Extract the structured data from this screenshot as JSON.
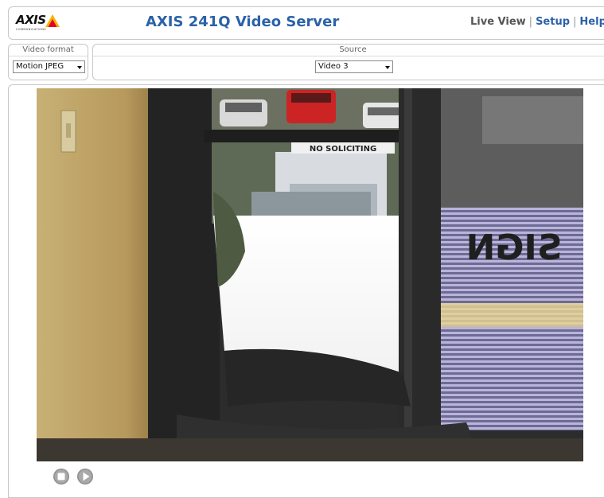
{
  "brand": {
    "logo_text": "AXIS",
    "logo_subtext": "COMMUNICATIONS",
    "logo_colors": [
      "#f6b400",
      "#e3002b"
    ]
  },
  "header": {
    "title": "AXIS 241Q Video Server",
    "title_color": "#2b62a8"
  },
  "nav": {
    "live_view": "Live View",
    "setup": "Setup",
    "help": "Help",
    "separator": "|"
  },
  "controls": {
    "video_format": {
      "label": "Video format",
      "value": "Motion JPEG"
    },
    "source": {
      "label": "Source",
      "value": "Video 3"
    }
  },
  "video": {
    "overlay_text": "NO SOLICITING",
    "window_text": "SIGN"
  },
  "playback": {
    "stop_icon": "stop-icon",
    "play_icon": "play-icon"
  }
}
